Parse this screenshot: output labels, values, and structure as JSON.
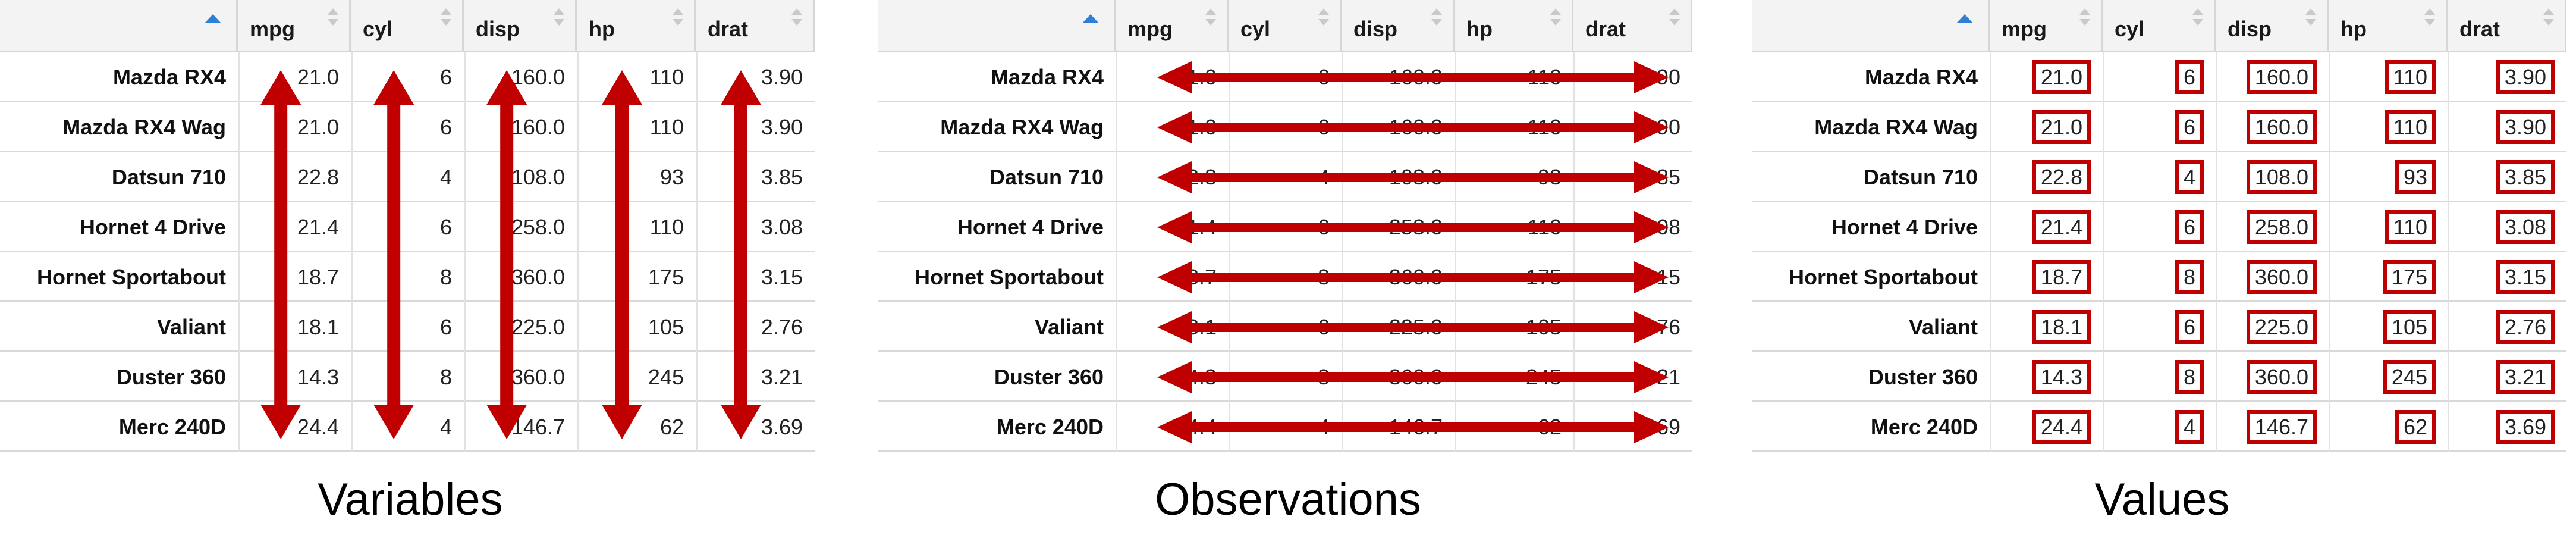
{
  "columns": [
    "mpg",
    "cyl",
    "disp",
    "hp",
    "drat"
  ],
  "rows": [
    {
      "name": "Mazda RX4",
      "values": [
        "21.0",
        "6",
        "160.0",
        "110",
        "3.90"
      ]
    },
    {
      "name": "Mazda RX4 Wag",
      "values": [
        "21.0",
        "6",
        "160.0",
        "110",
        "3.90"
      ]
    },
    {
      "name": "Datsun 710",
      "values": [
        "22.8",
        "4",
        "108.0",
        "93",
        "3.85"
      ]
    },
    {
      "name": "Hornet 4 Drive",
      "values": [
        "21.4",
        "6",
        "258.0",
        "110",
        "3.08"
      ]
    },
    {
      "name": "Hornet Sportabout",
      "values": [
        "18.7",
        "8",
        "360.0",
        "175",
        "3.15"
      ]
    },
    {
      "name": "Valiant",
      "values": [
        "18.1",
        "6",
        "225.0",
        "105",
        "2.76"
      ]
    },
    {
      "name": "Duster 360",
      "values": [
        "14.3",
        "8",
        "360.0",
        "245",
        "3.21"
      ]
    },
    {
      "name": "Merc 240D",
      "values": [
        "24.4",
        "4",
        "146.7",
        "62",
        "3.69"
      ]
    }
  ],
  "panels": [
    {
      "caption": "Variables",
      "annotation": "vertical-arrows"
    },
    {
      "caption": "Observations",
      "annotation": "horizontal-arrows"
    },
    {
      "caption": "Values",
      "annotation": "boxed-cells"
    }
  ],
  "colors": {
    "arrow": "#c00000",
    "sort_indicator": "#2f7ed8",
    "header_bg": "#f3f3f3"
  }
}
